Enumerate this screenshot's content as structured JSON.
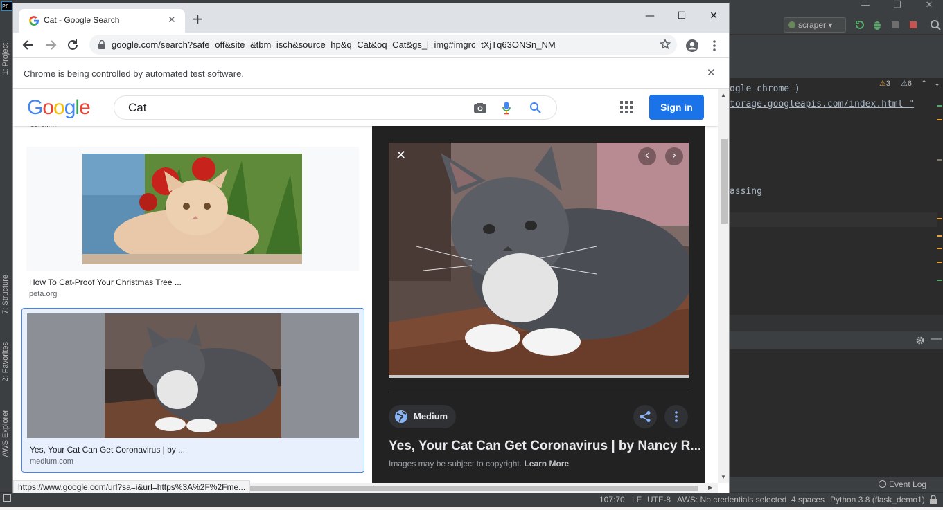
{
  "ide": {
    "logo_text": "PC",
    "run_config": "scraper",
    "code_lines": [
      "ogle chrome )",
      "torage.googleapis.com/index.html \"",
      "assing"
    ],
    "warnings_count": "3",
    "weak_warnings_count": "6",
    "sidebar_tabs": [
      "1: Project",
      "7: Structure",
      "2: Favorites",
      "AWS Explorer"
    ],
    "event_log": "Event Log",
    "status": {
      "position": "107:70",
      "line_sep": "LF",
      "encoding": "UTF-8",
      "aws": "AWS: No credentials selected",
      "indent": "4 spaces",
      "interpreter": "Python 3.8 (flask_demo1)"
    }
  },
  "chrome": {
    "tab_title": "Cat - Google Search",
    "url": "google.com/search?safe=off&site=&tbm=isch&source=hp&q=Cat&oq=Cat&gs_l=img#imgrc=tXjTq63ONSn_NM",
    "infobar_text": "Chrome is being controlled by automated test software.",
    "status_url": "https://www.google.com/url?sa=i&url=https%3A%2F%2Fme..."
  },
  "google": {
    "logo": [
      "G",
      "o",
      "o",
      "g",
      "l",
      "e"
    ],
    "logo_colors": [
      "#4285f4",
      "#ea4335",
      "#fbbc05",
      "#4285f4",
      "#34a853",
      "#ea4335"
    ],
    "query": "Cat",
    "sign_in": "Sign in",
    "cut_text": "scrolli...",
    "results": [
      {
        "caption": "How To Cat-Proof Your Christmas Tree ...",
        "domain": "peta.org"
      },
      {
        "caption": "Yes, Your Cat Can Get Coronavirus | by ...",
        "domain": "medium.com"
      }
    ],
    "preview": {
      "source": "Medium",
      "title": "Yes, Your Cat Can Get Coronavirus | by Nancy R...",
      "copyright": "Images may be subject to copyright.",
      "learn_more": "Learn More"
    }
  },
  "colors": {
    "accent": "#1a73e8",
    "preview_bg": "#222222",
    "ide_bg": "#2b2b2b"
  }
}
